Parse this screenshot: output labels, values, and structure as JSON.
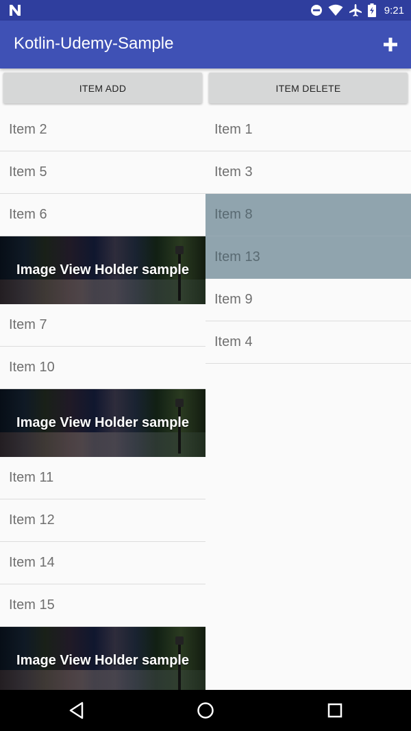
{
  "status_bar": {
    "time": "9:21",
    "icons": [
      "n-logo-icon",
      "do-not-disturb-icon",
      "wifi-icon",
      "airplane-icon",
      "battery-icon"
    ]
  },
  "app_bar": {
    "title": "Kotlin-Udemy-Sample",
    "add_icon": "plus-icon",
    "color": "#3f51b5"
  },
  "buttons": {
    "add_label": "ITEM ADD",
    "delete_label": "ITEM DELETE"
  },
  "left_list": [
    {
      "type": "item",
      "label": "Item 2"
    },
    {
      "type": "item",
      "label": "Item 5"
    },
    {
      "type": "item",
      "label": "Item 6"
    },
    {
      "type": "image",
      "label": "Image View Holder sample"
    },
    {
      "type": "item",
      "label": "Item 7"
    },
    {
      "type": "item",
      "label": "Item 10"
    },
    {
      "type": "image",
      "label": "Image View Holder sample"
    },
    {
      "type": "item",
      "label": "Item 11"
    },
    {
      "type": "item",
      "label": "Item 12"
    },
    {
      "type": "item",
      "label": "Item 14"
    },
    {
      "type": "item",
      "label": "Item 15"
    },
    {
      "type": "image",
      "label": "Image View Holder sample"
    }
  ],
  "right_list": [
    {
      "label": "Item 1",
      "selected": false
    },
    {
      "label": "Item 3",
      "selected": false
    },
    {
      "label": "Item 8",
      "selected": true
    },
    {
      "label": "Item 13",
      "selected": true
    },
    {
      "label": "Item 9",
      "selected": false
    },
    {
      "label": "Item 4",
      "selected": false
    }
  ],
  "colors": {
    "status_bar": "#2f3e9e",
    "selected_row": "#90a4ae"
  },
  "nav_bar": {
    "icons": [
      "back-icon",
      "home-icon",
      "recents-icon"
    ]
  }
}
